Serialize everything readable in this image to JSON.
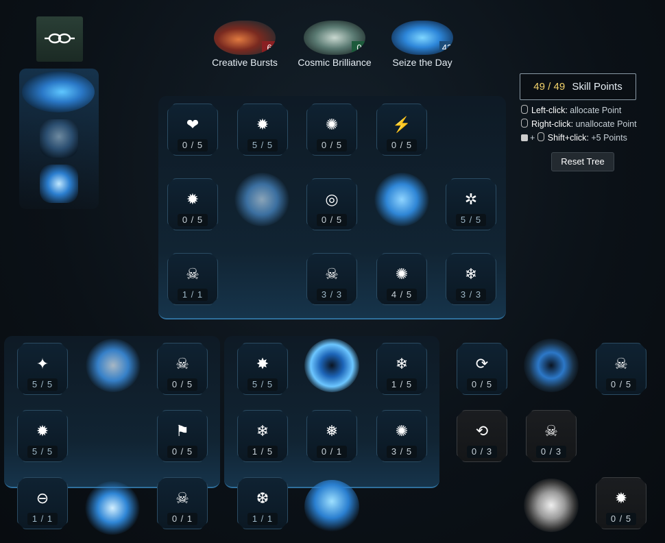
{
  "tabs": [
    {
      "label": "Creative Bursts",
      "count": "6",
      "count_color": "#8a1f22"
    },
    {
      "label": "Cosmic Brilliance",
      "count": "0",
      "count_color": "#1d5b3c"
    },
    {
      "label": "Seize the Day",
      "count": "43",
      "count_color": "#1c4d7a"
    }
  ],
  "skill_points": {
    "value": "49 / 49",
    "label": "Skill Points"
  },
  "help": {
    "left_key": "Left-click:",
    "left_text": "allocate Point",
    "right_key": "Right-click:",
    "right_text": "unallocate Point",
    "shift_prefix": "+",
    "shift_key": "Shift+click:",
    "shift_text": "+5 Points"
  },
  "reset_label": "Reset Tree",
  "nodes": {
    "t1": "0 / 5",
    "t2": "5 / 5",
    "t3": "0 / 5",
    "t4": "0 / 5",
    "t5": "0 / 5",
    "t6": "0 / 5",
    "t7": "5 / 5",
    "t8": "1 / 1",
    "t9": "3 / 3",
    "t10": "4 / 5",
    "t11": "3 / 3",
    "l1": "5 / 5",
    "l2": "0 / 5",
    "l3": "5 / 5",
    "l4": "0 / 5",
    "l5": "1 / 1",
    "l6": "0 / 1",
    "m1": "5 / 5",
    "m2": "1 / 5",
    "m3": "1 / 5",
    "m4": "0 / 1",
    "m5": "3 / 5",
    "m6": "1 / 1",
    "r1": "0 / 5",
    "r2": "0 / 5",
    "r3": "0 / 3",
    "r4": "0 / 3",
    "r5": "0 / 5"
  },
  "icons": {
    "emblem": "infinity-link-icon",
    "heart": "heart-icon",
    "crown": "crown-burst-icon",
    "sun": "sun-burst-icon",
    "strike": "figure-strike-icon",
    "target": "crosshair-icon",
    "vortex": "vortex-icon",
    "skull": "skull-icon",
    "snow": "snowflake-icon",
    "spark": "spark-icon",
    "gun": "gun-icon",
    "boot": "boot-icon"
  },
  "colors": {
    "accent_gold": "#f3d36b",
    "accent_blue": "#2f6f9c"
  }
}
